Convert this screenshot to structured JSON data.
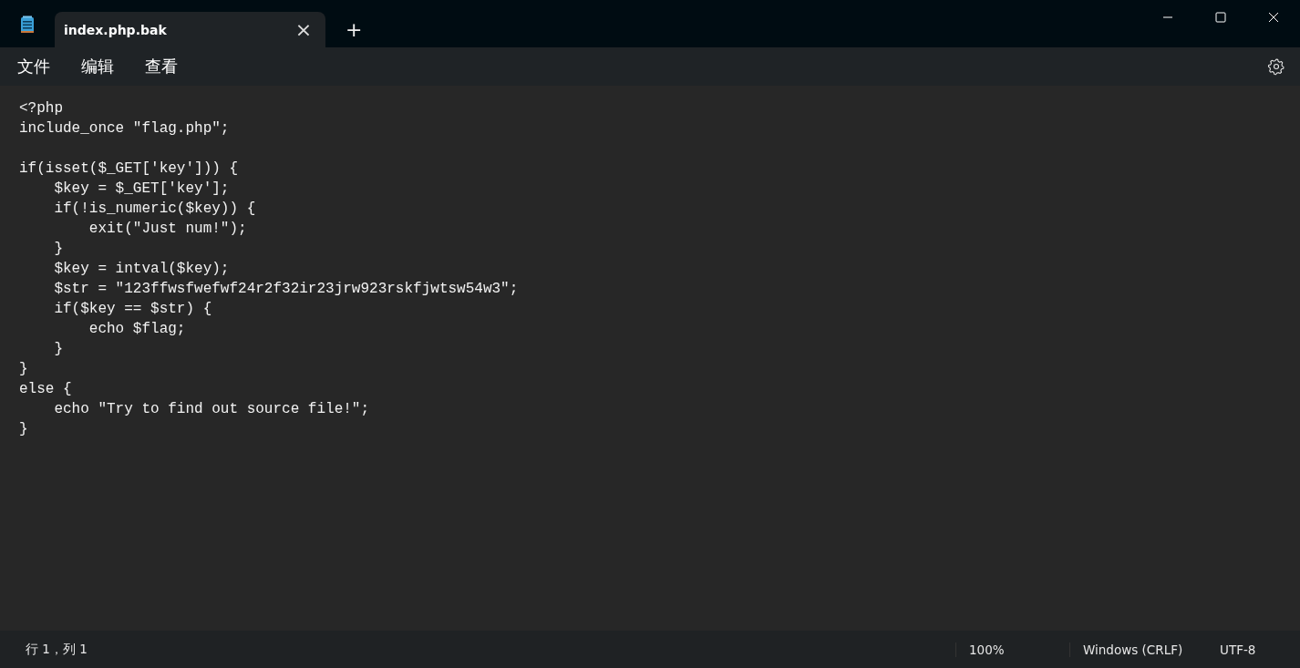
{
  "tabs": [
    {
      "title": "index.php.bak",
      "selected": true,
      "close": "×"
    }
  ],
  "new_tab": "+",
  "menu": [
    "文件",
    "编辑",
    "查看"
  ],
  "editor": {
    "text": "<?php\ninclude_once \"flag.php\";\n\nif(isset($_GET['key'])) {\n    $key = $_GET['key'];\n    if(!is_numeric($key)) {\n        exit(\"Just num!\");\n    }\n    $key = intval($key);\n    $str = \"123ffwsfwefwf24r2f32ir23jrw923rskfjwtsw54w3\";\n    if($key == $str) {\n        echo $flag;\n    }\n}\nelse {\n    echo \"Try to find out source file!\";\n}"
  },
  "status_bar": {
    "position": "行 1，列 1",
    "zoom": "100%",
    "line_ending": "Windows (CRLF)",
    "encoding": "UTF-8"
  }
}
